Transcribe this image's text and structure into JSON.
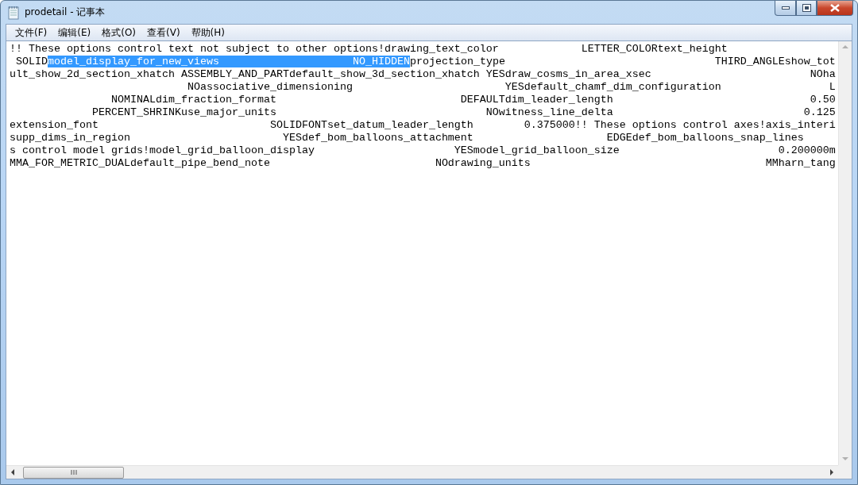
{
  "window": {
    "title": "prodetail - 记事本"
  },
  "menu": [
    {
      "label": "文件(F)"
    },
    {
      "label": "编辑(E)"
    },
    {
      "label": "格式(O)"
    },
    {
      "label": "查看(V)"
    },
    {
      "label": "帮助(H)"
    }
  ],
  "editor": {
    "lines": [
      {
        "segments": [
          {
            "text": "!! These options control text not subject to other options!drawing_text_color             LETTER_COLORtext_height",
            "selected": false
          }
        ]
      },
      {
        "segments": [
          {
            "text": " SOLID",
            "selected": false
          },
          {
            "text": "model_display_for_new_views                     NO_HIDDEN",
            "selected": true
          },
          {
            "text": "projection_type                                 THIRD_ANGLEshow_tot",
            "selected": false
          }
        ]
      },
      {
        "segments": [
          {
            "text": "ult_show_2d_section_xhatch ASSEMBLY_AND_PARTdefault_show_3d_section_xhatch YESdraw_cosms_in_area_xsec                         NOha",
            "selected": false
          }
        ]
      },
      {
        "segments": [
          {
            "text": "                            NOassociative_dimensioning                        YESdefault_chamf_dim_configuration                 L",
            "selected": false
          }
        ]
      },
      {
        "segments": [
          {
            "text": "                NOMINALdim_fraction_format                             DEFAULTdim_leader_length                               0.50",
            "selected": false
          }
        ]
      },
      {
        "segments": [
          {
            "text": "             PERCENT_SHRINKuse_major_units                                 NOwitness_line_delta                              0.125",
            "selected": false
          }
        ]
      },
      {
        "segments": [
          {
            "text": "extension_font                           SOLIDFONTset_datum_leader_length        0.375000!! These options control axes!axis_interi",
            "selected": false
          }
        ]
      },
      {
        "segments": [
          {
            "text": "supp_dims_in_region                        YESdef_bom_balloons_attachment                     EDGEdef_bom_balloons_snap_lines",
            "selected": false
          }
        ]
      },
      {
        "segments": [
          {
            "text": "s control model grids!model_grid_balloon_display                      YESmodel_grid_balloon_size                         0.200000m",
            "selected": false
          }
        ]
      },
      {
        "segments": [
          {
            "text": "MMA_FOR_METRIC_DUALdefault_pipe_bend_note                          NOdrawing_units                                     MMharn_tang",
            "selected": false
          }
        ]
      }
    ]
  }
}
